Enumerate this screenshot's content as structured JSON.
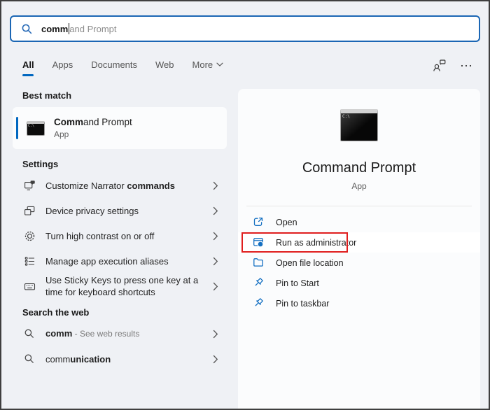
{
  "search": {
    "typed": "comm",
    "suggestion": "and Prompt"
  },
  "tabs": {
    "all": "All",
    "apps": "Apps",
    "documents": "Documents",
    "web": "Web",
    "more": "More"
  },
  "left": {
    "best_match_header": "Best match",
    "best_match": {
      "title_match": "Comm",
      "title_rest": "and Prompt",
      "subtitle": "App"
    },
    "settings_header": "Settings",
    "settings": [
      {
        "pre": "Customize Narrator ",
        "bold": "commands"
      },
      {
        "pre": "Device privacy settings",
        "bold": ""
      },
      {
        "pre": "Turn high contrast on or off",
        "bold": ""
      },
      {
        "pre": "Manage app execution aliases",
        "bold": ""
      },
      {
        "pre": "Use Sticky Keys to press one key at a time for keyboard shortcuts",
        "bold": ""
      }
    ],
    "web_header": "Search the web",
    "web": [
      {
        "lead": "comm",
        "bold": "",
        "note": " - See web results"
      },
      {
        "lead": "comm",
        "bold": "unication",
        "note": ""
      }
    ]
  },
  "right": {
    "title": "Command Prompt",
    "subtitle": "App",
    "actions": [
      {
        "label": "Open"
      },
      {
        "label": "Run as administrator"
      },
      {
        "label": "Open file location"
      },
      {
        "label": "Pin to Start"
      },
      {
        "label": "Pin to taskbar"
      }
    ]
  },
  "cmd_icon_text": "C:\\",
  "colors": {
    "accent": "#0067c0",
    "action_icon_blue": "#1570c2",
    "annotation_red": "#e01e1e",
    "search_border_blue": "#1b66b4"
  }
}
